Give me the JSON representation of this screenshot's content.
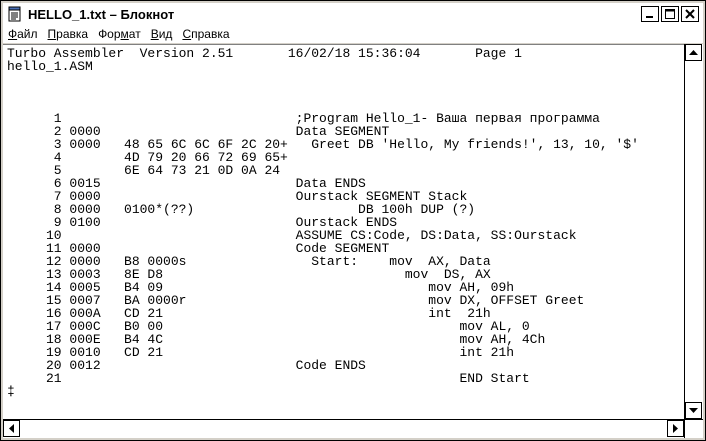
{
  "window": {
    "title": "HELLO_1.txt – Блокнот",
    "icon": "notepad-icon"
  },
  "title_buttons": {
    "minimize_icon": "minimize-icon",
    "maximize_icon": "maximize-icon",
    "close_icon": "close-icon"
  },
  "menu": {
    "items": [
      {
        "accel": "Ф",
        "rest": "айл"
      },
      {
        "accel": "П",
        "rest": "равка"
      },
      {
        "pre": "Фор",
        "accel": "м",
        "rest": "ат"
      },
      {
        "accel": "В",
        "rest": "ид"
      },
      {
        "accel": "С",
        "rest": "правка"
      }
    ]
  },
  "editor": {
    "lines": [
      "Turbo Assembler  Version 2.51       16/02/18 15:36:04       Page 1",
      "hello_1.ASM",
      "",
      "",
      "",
      "      1                              ;Program Hello_1- Ваша первая программа",
      "      2 0000                         Data SEGMENT",
      "      3 0000   48 65 6C 6C 6F 2C 20+   Greet DB 'Hello, My friends!', 13, 10, '$'",
      "      4        4D 79 20 66 72 69 65+",
      "      5        6E 64 73 21 0D 0A 24",
      "      6 0015                         Data ENDS",
      "      7 0000                         Ourstack SEGMENT Stack",
      "      8 0000   0100*(??)                     DB 100h DUP (?)",
      "      9 0100                         Ourstack ENDS",
      "     10                              ASSUME CS:Code, DS:Data, SS:Ourstack",
      "     11 0000                         Code SEGMENT",
      "     12 0000   B8 0000s                Start:    mov  AX, Data",
      "     13 0003   8E D8                               mov  DS, AX",
      "     14 0005   B4 09                                  mov AH, 09h",
      "     15 0007   BA 0000r                               mov DX, OFFSET Greet",
      "     16 000A   CD 21                                  int  21h",
      "     17 000C   B0 00                                      mov AL, 0",
      "     18 000E   B4 4C                                      mov AH, 4Ch",
      "     19 0010   CD 21                                      int 21h",
      "     20 0012                         Code ENDS",
      "     21                                                   END Start",
      "‡"
    ]
  }
}
